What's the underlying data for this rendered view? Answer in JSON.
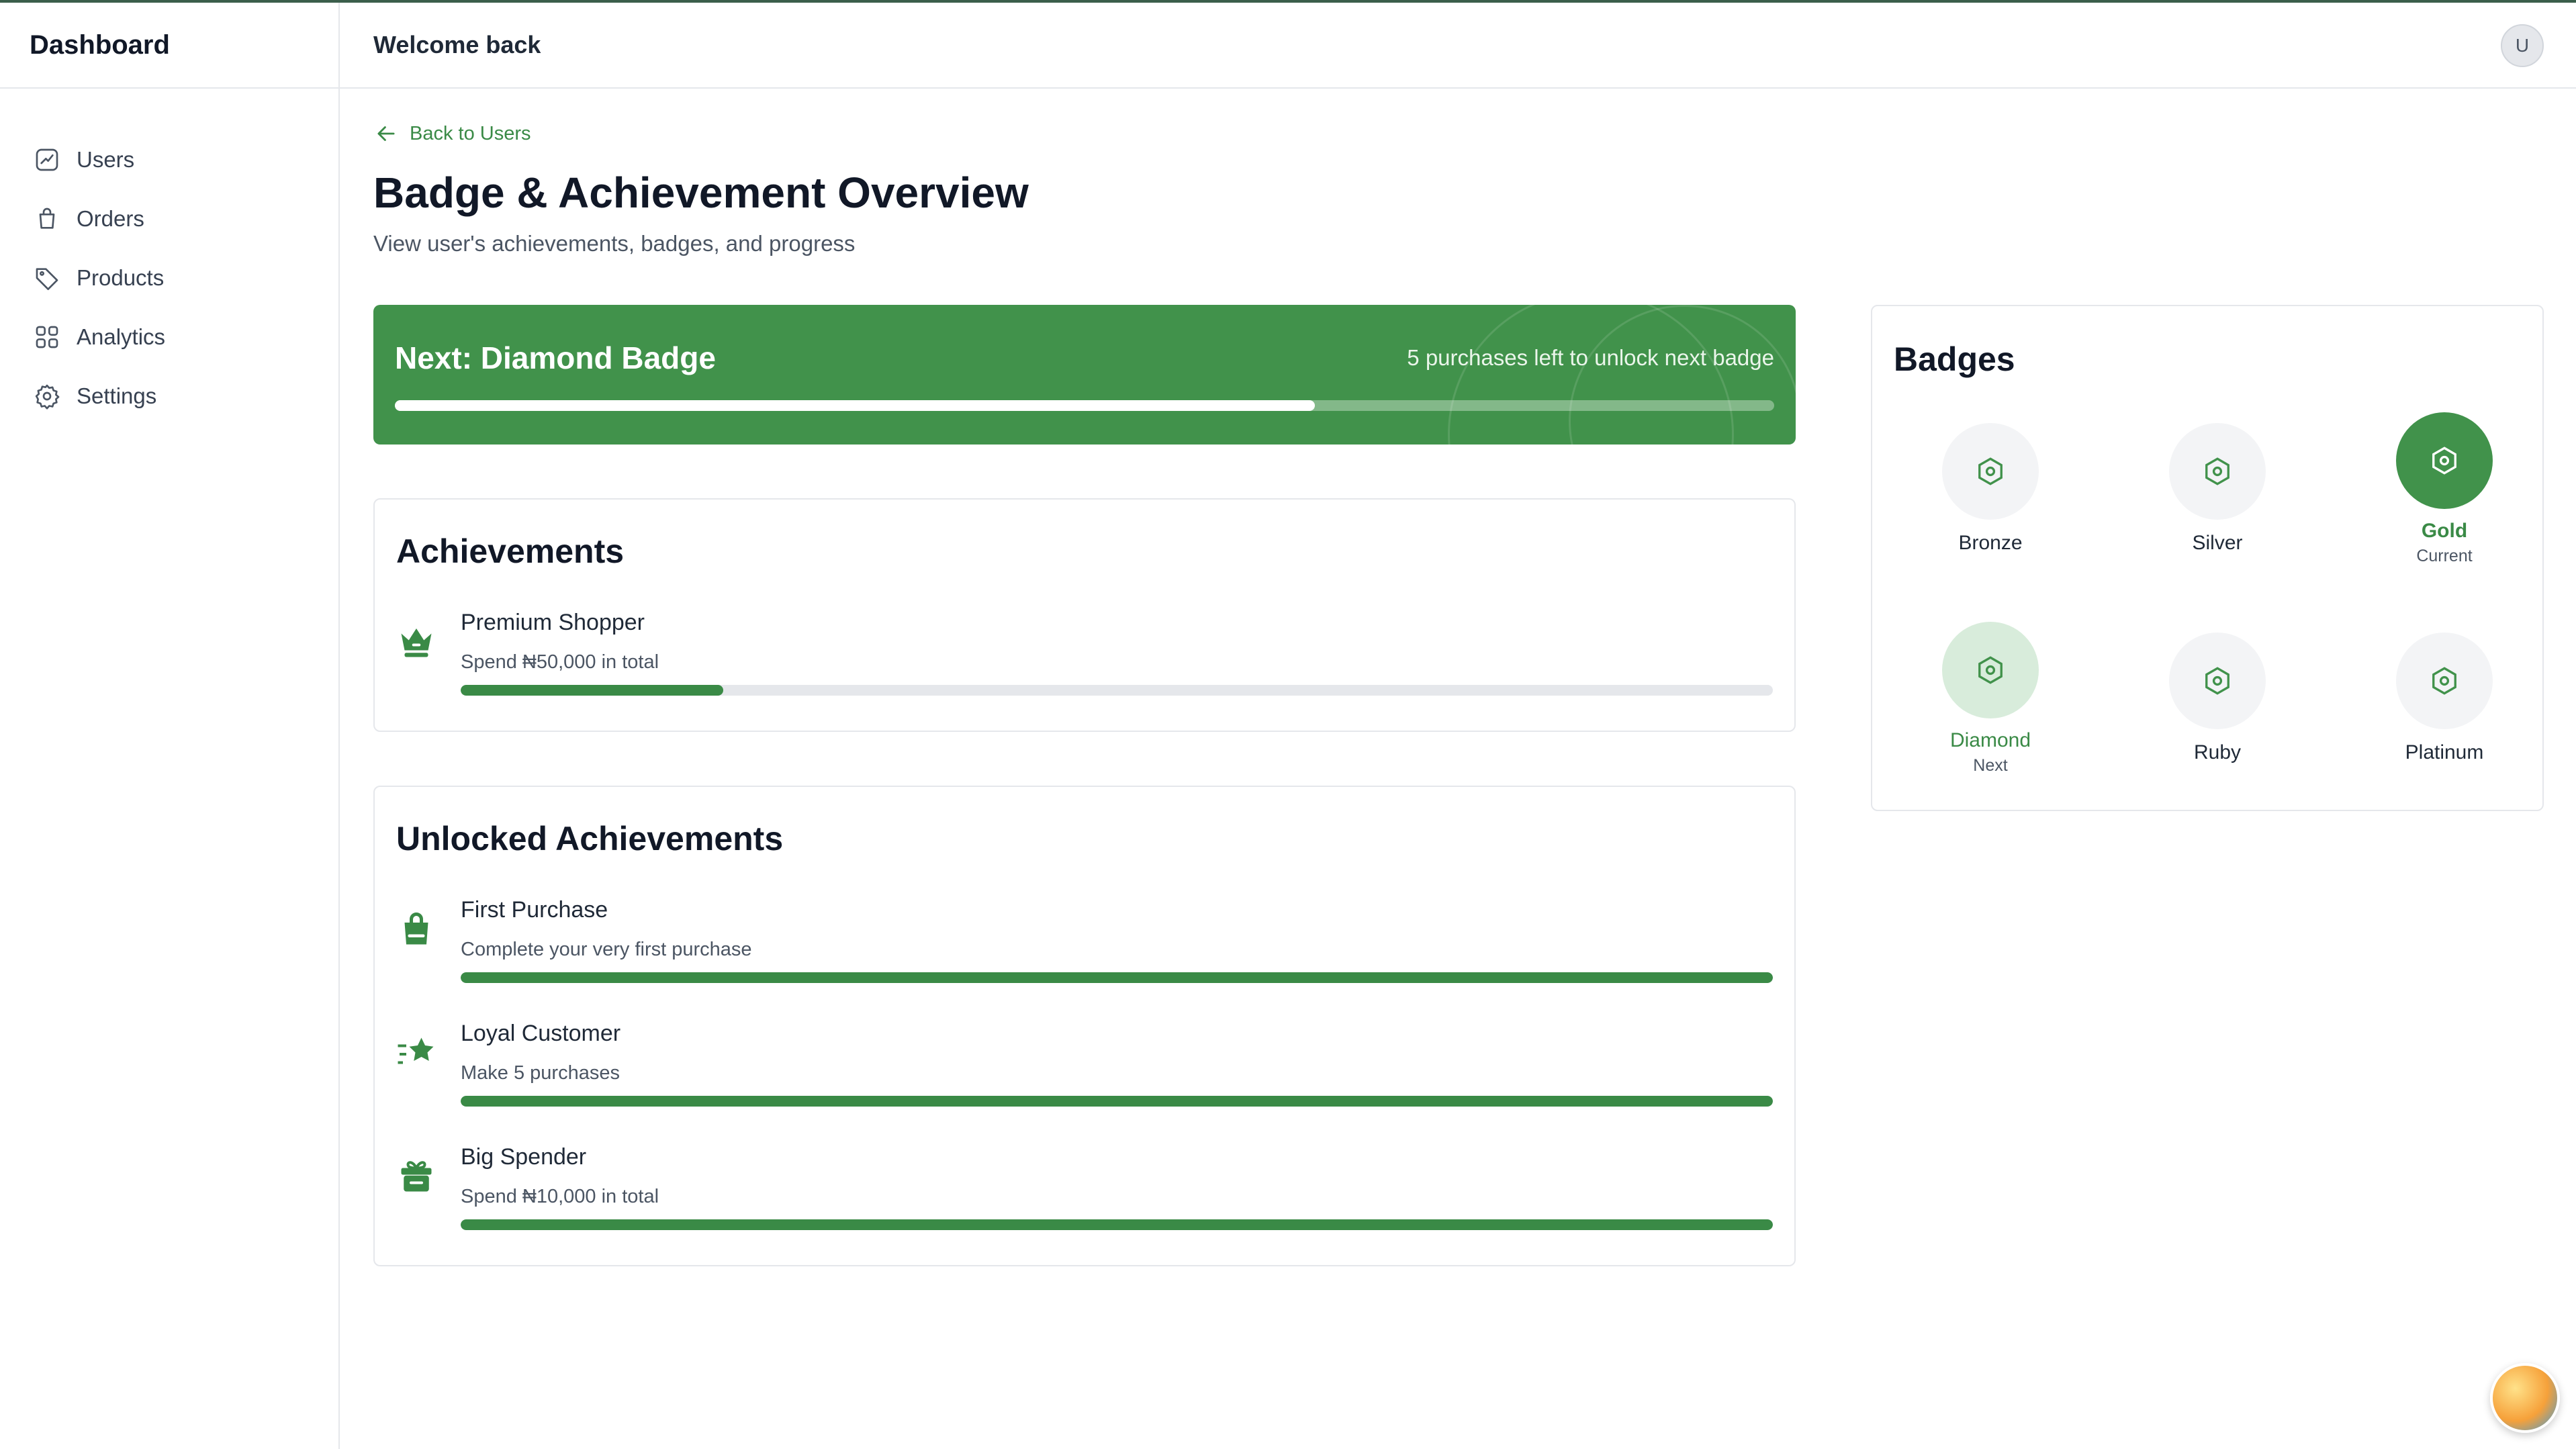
{
  "sidebar": {
    "brand": "Dashboard",
    "items": [
      {
        "label": "Users",
        "icon": "trending-chart-icon"
      },
      {
        "label": "Orders",
        "icon": "shopping-bag-icon"
      },
      {
        "label": "Products",
        "icon": "tag-icon"
      },
      {
        "label": "Analytics",
        "icon": "grid-icon"
      },
      {
        "label": "Settings",
        "icon": "gear-icon"
      }
    ]
  },
  "header": {
    "title": "Welcome back",
    "avatar_initial": "U"
  },
  "main": {
    "back_link": "Back to Users",
    "title": "Badge & Achievement Overview",
    "subtitle": "View user's achievements, badges, and progress",
    "next_badge": {
      "title": "Next: Diamond Badge",
      "note": "5 purchases left to unlock next badge",
      "progress": 0.667
    },
    "achievements": {
      "title": "Achievements",
      "items": [
        {
          "name": "Premium Shopper",
          "desc": "Spend ₦50,000 in total",
          "progress": 0.2,
          "icon": "crown-icon"
        }
      ]
    },
    "unlocked": {
      "title": "Unlocked Achievements",
      "items": [
        {
          "name": "First Purchase",
          "desc": "Complete your very first purchase",
          "progress": 1.0,
          "icon": "shopping-bag-icon"
        },
        {
          "name": "Loyal Customer",
          "desc": "Make 5 purchases",
          "progress": 1.0,
          "icon": "star-icon"
        },
        {
          "name": "Big Spender",
          "desc": "Spend ₦10,000 in total",
          "progress": 1.0,
          "icon": "gift-box-icon"
        }
      ]
    }
  },
  "badges": {
    "title": "Badges",
    "items": [
      {
        "name": "Bronze",
        "sub": "",
        "state": "locked"
      },
      {
        "name": "Silver",
        "sub": "",
        "state": "locked"
      },
      {
        "name": "Gold",
        "sub": "Current",
        "state": "current"
      },
      {
        "name": "Diamond",
        "sub": "Next",
        "state": "next"
      },
      {
        "name": "Ruby",
        "sub": "",
        "state": "locked"
      },
      {
        "name": "Platinum",
        "sub": "",
        "state": "locked"
      }
    ]
  },
  "colors": {
    "accent": "#41924b",
    "accent_text": "#3a8a46",
    "track": "#e5e7eb"
  }
}
